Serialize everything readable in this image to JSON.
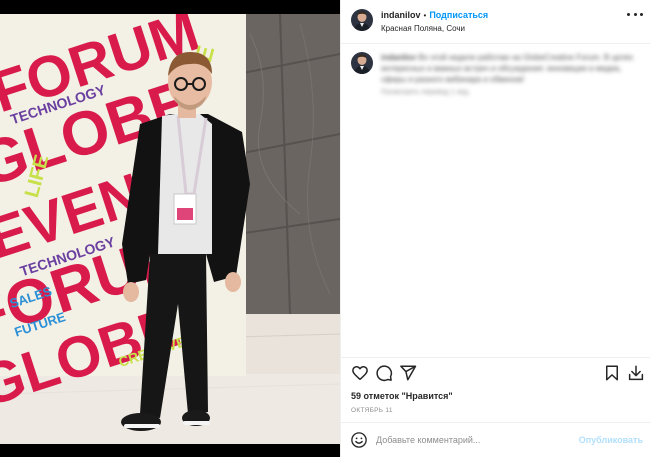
{
  "post": {
    "username": "indanilov",
    "separator": "•",
    "follow_label": "Подписаться",
    "location": "Красная Поляна, Сочи",
    "caption_user": "indanilov",
    "caption_text": "Во этой неделе работаю на GlobeCreative Forum. В целях интересных и важных встреч и обсуждения: инновации и медиа, сферы и разного вебинара и обменов!",
    "caption_meta": "Посмотреть перевод   1 нед."
  },
  "icons": {
    "more": "more-options-icon",
    "like": "heart-icon",
    "comment": "comment-icon",
    "share": "paper-plane-icon",
    "save": "bookmark-icon",
    "download": "download-icon",
    "emoji": "emoji-icon"
  },
  "stats": {
    "likes_text": "59 отметок \"Нравится\"",
    "date_text": "ОКТЯБРЬ 11"
  },
  "comment_box": {
    "placeholder": "Добавьте комментарий...",
    "publish_label": "Опубликовать"
  },
  "colors": {
    "accent": "#0095f6",
    "publish_disabled": "#b2dffc",
    "text": "#262626",
    "muted": "#8e8e8e",
    "poster_red": "#d81b4a",
    "poster_lime": "#c8e04a"
  }
}
